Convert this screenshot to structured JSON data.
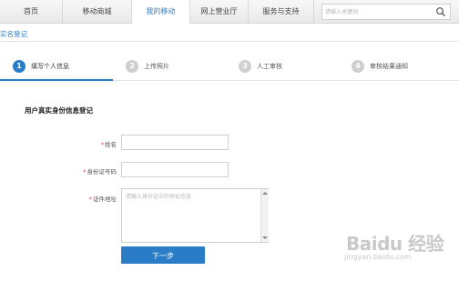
{
  "nav": {
    "items": [
      {
        "label": "首页",
        "active": false
      },
      {
        "label": "移动商城",
        "active": false
      },
      {
        "label": "我的移动",
        "active": true
      },
      {
        "label": "网上营业厅",
        "active": false
      },
      {
        "label": "服务与支持",
        "active": false
      }
    ],
    "search_placeholder": "请输入关键词",
    "accent": "#2a7cc7"
  },
  "page": {
    "title": "实名登记"
  },
  "steps": [
    {
      "num": "1",
      "label": "填写个人信息",
      "active": true
    },
    {
      "num": "2",
      "label": "上传照片",
      "active": false
    },
    {
      "num": "3",
      "label": "人工审核",
      "active": false
    },
    {
      "num": "4",
      "label": "审核结果通知",
      "active": false
    }
  ],
  "form": {
    "section_title": "用户真实身份信息登记",
    "required_mark": "*",
    "name_label": "姓名",
    "id_label": "身份证号码",
    "address_label": "证件地址",
    "address_placeholder": "请输入身份证中的地址信息",
    "next_button": "下一步"
  },
  "watermark": {
    "brand": "Baidu 经验",
    "sub": "jingyan.baidu.com"
  }
}
